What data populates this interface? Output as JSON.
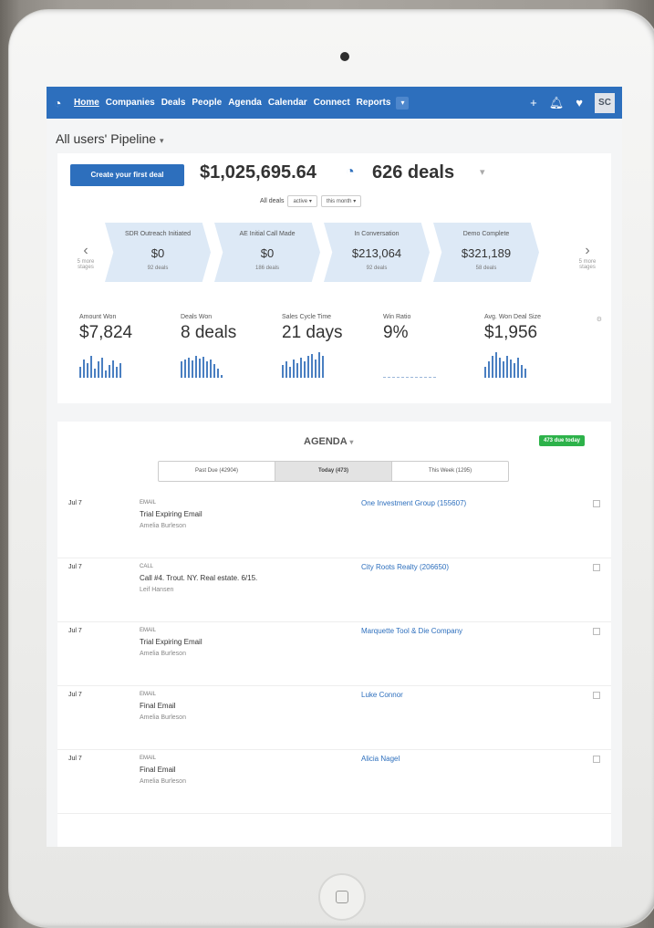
{
  "nav": {
    "items": [
      "Home",
      "Companies",
      "Deals",
      "People",
      "Agenda",
      "Calendar",
      "Connect",
      "Reports"
    ],
    "avatar": "SC"
  },
  "pipeline": {
    "title": "All users' Pipeline",
    "create_label": "Create your first deal",
    "total": "$1,025,695.64",
    "deal_count": "626 deals",
    "filter_label": "All deals",
    "filter_status": "active",
    "filter_period": "this month",
    "prev_label": "5 more stages",
    "next_label": "5 more stages",
    "stages": [
      {
        "name": "SDR Outreach Initiated",
        "amount": "$0",
        "count": "92 deals"
      },
      {
        "name": "AE Initial Call Made",
        "amount": "$0",
        "count": "186 deals"
      },
      {
        "name": "In Conversation",
        "amount": "$213,064",
        "count": "92 deals"
      },
      {
        "name": "Demo Complete",
        "amount": "$321,189",
        "count": "58 deals"
      }
    ],
    "metrics": [
      {
        "label": "Amount Won",
        "value": "$7,824"
      },
      {
        "label": "Deals Won",
        "value": "8 deals"
      },
      {
        "label": "Sales Cycle Time",
        "value": "21 days"
      },
      {
        "label": "Win Ratio",
        "value": "9%"
      },
      {
        "label": "Avg. Won Deal Size",
        "value": "$1,956"
      }
    ]
  },
  "agenda": {
    "title": "AGENDA",
    "due_badge": "473 due today",
    "tabs": [
      "Past Due (42904)",
      "Today (473)",
      "This Week (1295)"
    ],
    "rows": [
      {
        "date": "Jul 7",
        "type": "EMAIL",
        "title": "Trial Expiring Email",
        "owner": "Amelia Burleson",
        "link": "One Investment Group (155607)"
      },
      {
        "date": "Jul 7",
        "type": "CALL",
        "title": "Call #4. Trout. NY. Real estate. 6/15.",
        "owner": "Leif Hansen",
        "link": "City Roots Realty (206650)"
      },
      {
        "date": "Jul 7",
        "type": "EMAIL",
        "title": "Trial Expiring Email",
        "owner": "Amelia Burleson",
        "link": "Marquette Tool & Die Company"
      },
      {
        "date": "Jul 7",
        "type": "EMAIL",
        "title": "Final Email",
        "owner": "Amelia Burleson",
        "link": "Luke Connor"
      },
      {
        "date": "Jul 7",
        "type": "EMAIL",
        "title": "Final Email",
        "owner": "Amelia Burleson",
        "link": "Alicia Nagel"
      }
    ]
  },
  "colors": {
    "brand": "#2d6fbd",
    "success": "#2db24a",
    "stage_fill": "#dde9f6"
  },
  "icons": {
    "logo": "pipeline-logo-icon",
    "add": "plus-icon",
    "notify": "bell-icon",
    "favorite": "heart-icon"
  }
}
